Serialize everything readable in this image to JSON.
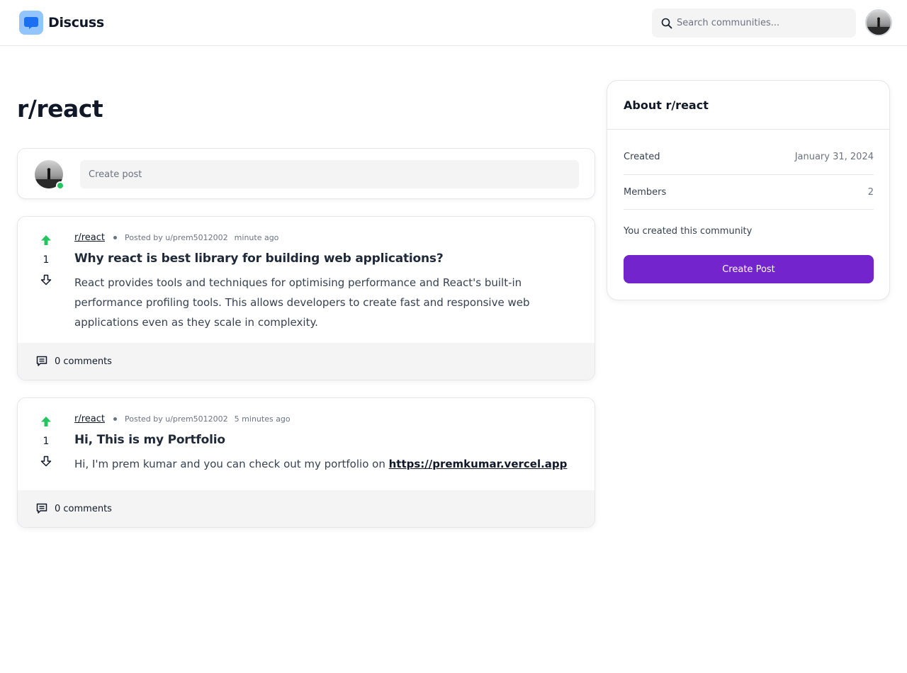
{
  "header": {
    "brand": "Discuss",
    "logo_icon": "chat-bubble-icon",
    "search_placeholder": "Search communities...",
    "search_icon": "search-icon",
    "accent_color": "#93c5fd"
  },
  "page": {
    "title": "r/react",
    "create_post_placeholder": "Create post"
  },
  "posts": [
    {
      "subreddit": "r/react",
      "posted_by": "Posted by u/prem5012002",
      "time": "minute ago",
      "votes": "1",
      "title": "Why react is best library for building web applications?",
      "body": "React provides tools and techniques for optimising performance and React's built-in performance profiling tools. This allows developers to create fast and responsive web applications even as they scale in complexity.",
      "comments": "0 comments"
    },
    {
      "subreddit": "r/react",
      "posted_by": "Posted by u/prem5012002",
      "time": "5 minutes ago",
      "votes": "1",
      "title": "Hi, This is my Portfolio",
      "body": "Hi, I'm prem kumar and you can check out my portfolio on ",
      "link": "https://premkumar.vercel.app",
      "comments": "0 comments"
    }
  ],
  "about": {
    "title": "About r/react",
    "created_label": "Created",
    "created_value": "January 31, 2024",
    "members_label": "Members",
    "members_value": "2",
    "note": "You created this community",
    "button": "Create Post",
    "button_color": "#7324cc"
  },
  "colors": {
    "upvote": "#22c55e",
    "online": "#22c55e"
  }
}
